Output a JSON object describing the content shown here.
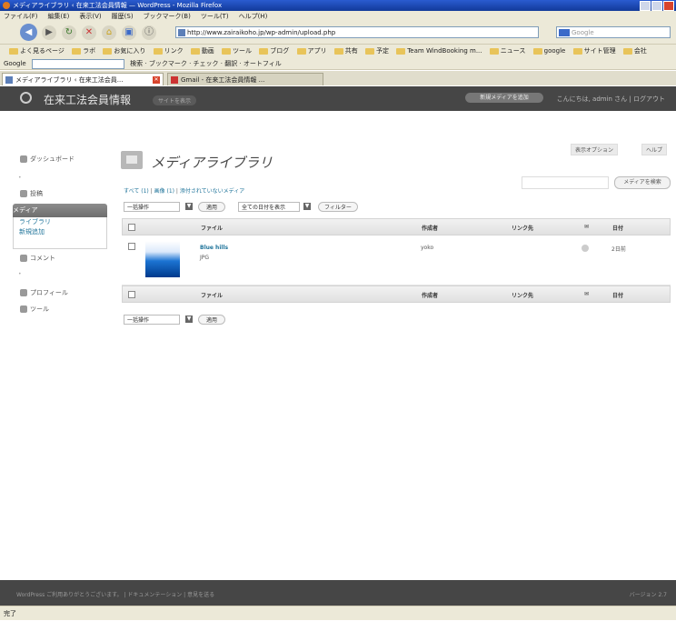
{
  "window": {
    "title": "メディアライブラリ ‹ 在来工法会員情報 — WordPress - Mozilla Firefox"
  },
  "menubar": [
    "ファイル(F)",
    "編集(E)",
    "表示(V)",
    "履歴(S)",
    "ブックマーク(B)",
    "ツール(T)",
    "ヘルプ(H)"
  ],
  "navbar": {
    "url": "http://www.zairaikoho.jp/wp-admin/upload.php",
    "search_placeholder": "Google"
  },
  "bookmarks": [
    "よく見るページ",
    "ラボ",
    "お気に入り",
    "リンク",
    "動画",
    "ツール",
    "ブログ",
    "アプリ",
    "共有",
    "予定",
    "Team WindBooking m...",
    "ニュース",
    "google",
    "サイト管理",
    "会社"
  ],
  "googlebar": {
    "label": "Google",
    "items": [
      "検索",
      "ブックマーク",
      "チェック",
      "翻訳",
      "オートフィル"
    ]
  },
  "tabs": [
    {
      "label": "メディアライブラリ ‹ 在来工法会員...",
      "active": true
    },
    {
      "label": "Gmail - 在来工法会員情報 ...",
      "active": false
    }
  ],
  "wp": {
    "site_title": "在来工法会員情報",
    "visit_site": "サイトを表示",
    "favorite_action": "新規メディアを追加",
    "howdy": "こんにちは, admin さん | ログアウト",
    "screen_options": "表示オプション",
    "help": "ヘルプ"
  },
  "sidebar": {
    "dashboard": "ダッシュボード",
    "posts": "投稿",
    "media": "メディア",
    "media_sub": [
      "ライブラリ",
      "新規追加"
    ],
    "comments": "コメント",
    "appearance": "プロフィール",
    "tools": "ツール"
  },
  "main": {
    "title": "メディアライブラリ",
    "filters": {
      "all": "すべて (1)",
      "image": "画像 (1)",
      "unattached": "添付されていないメディア"
    },
    "search_button": "メディアを検索",
    "bulk_action": "一括操作",
    "apply": "適用",
    "date_filter": "全ての日付を表示",
    "filter_button": "フィルター",
    "columns": {
      "file": "ファイル",
      "author": "作成者",
      "attached": "リンク先",
      "comments": "✉",
      "date": "日付"
    },
    "rows": [
      {
        "title": "Blue hills",
        "ext": "JPG",
        "author": "yoko",
        "date": "2日前"
      }
    ]
  },
  "footer": {
    "left": "WordPress ご利用ありがとうございます。 | ドキュメンテーション | 意見を送る",
    "right": "バージョン 2.7"
  },
  "statusbar": "完了"
}
